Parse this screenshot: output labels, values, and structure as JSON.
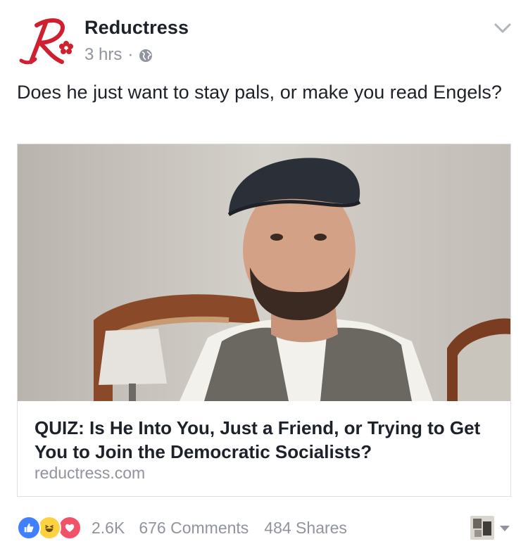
{
  "page": {
    "name": "Reductress",
    "time": "3 hrs",
    "separator": "·",
    "audience_icon": "globe-icon",
    "menu_icon": "chevron-down-icon"
  },
  "post": {
    "text": "Does he just want to stay pals, or make you read Engels?"
  },
  "link": {
    "title": "QUIZ: Is He Into You, Just a Friend, or Trying to Get You to Join the Democratic Socialists?",
    "domain": "reductress.com"
  },
  "engagement": {
    "reactions": [
      "like-icon",
      "haha-icon",
      "love-icon"
    ],
    "reaction_count": "2.6K",
    "comments": "676 Comments",
    "shares": "484 Shares"
  },
  "colors": {
    "brand_red": "#d0202f",
    "like_blue": "#4080ff",
    "haha_yellow": "#fcd240",
    "love_red": "#f25268",
    "meta_gray": "#90949c"
  }
}
